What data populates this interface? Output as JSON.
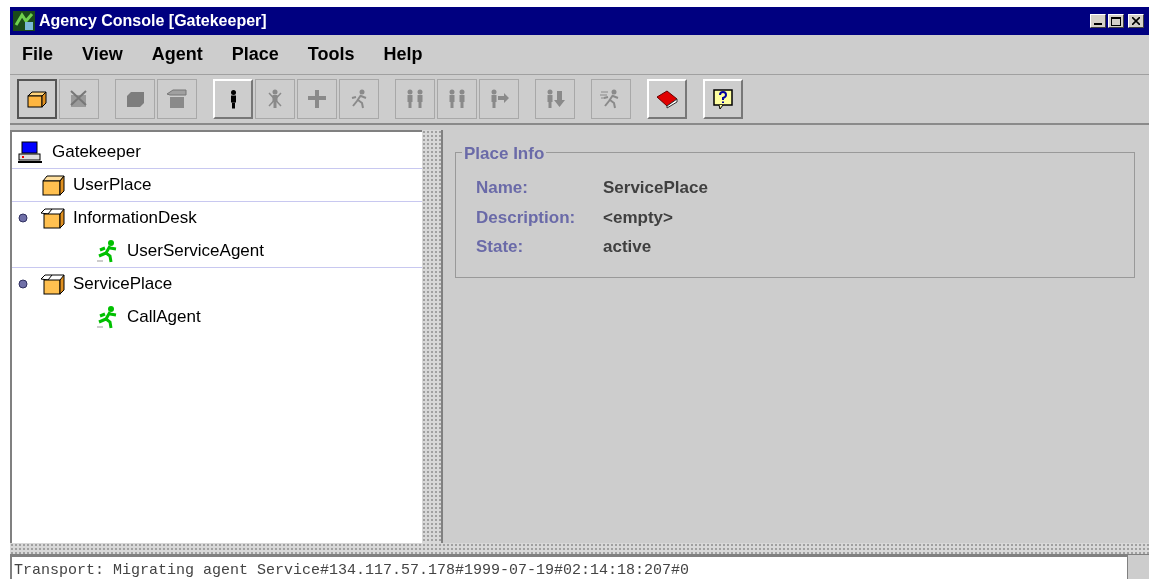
{
  "window": {
    "title": "Agency Console [Gatekeeper]"
  },
  "menu": [
    {
      "label": "File"
    },
    {
      "label": "View"
    },
    {
      "label": "Agent"
    },
    {
      "label": "Place"
    },
    {
      "label": "Tools"
    },
    {
      "label": "Help"
    }
  ],
  "toolbar": [
    [
      {
        "kind": "box",
        "disabled": false,
        "selected": true
      },
      {
        "kind": "box-x",
        "disabled": true,
        "selected": false
      }
    ],
    [
      {
        "kind": "cube",
        "disabled": true,
        "selected": false
      },
      {
        "kind": "box-open",
        "disabled": true,
        "selected": false
      }
    ],
    [
      {
        "kind": "person",
        "disabled": false,
        "selected": false
      },
      {
        "kind": "person-x",
        "disabled": true,
        "selected": false
      },
      {
        "kind": "person-plus",
        "disabled": true,
        "selected": false
      },
      {
        "kind": "runner",
        "disabled": true,
        "selected": false
      }
    ],
    [
      {
        "kind": "pair",
        "disabled": true,
        "selected": false
      },
      {
        "kind": "pair",
        "disabled": true,
        "selected": false
      },
      {
        "kind": "person-right",
        "disabled": true,
        "selected": false
      }
    ],
    [
      {
        "kind": "person-down",
        "disabled": true,
        "selected": false
      }
    ],
    [
      {
        "kind": "runner-fast",
        "disabled": true,
        "selected": false
      }
    ],
    [
      {
        "kind": "book",
        "disabled": false,
        "selected": false
      }
    ],
    [
      {
        "kind": "help",
        "disabled": false,
        "selected": false
      }
    ]
  ],
  "tree": {
    "label": "Gatekeeper",
    "kind": "host",
    "children": [
      {
        "label": "UserPlace",
        "kind": "place",
        "marked": false
      },
      {
        "label": "InformationDesk",
        "kind": "place-open",
        "marked": true,
        "children": [
          {
            "label": "UserServiceAgent",
            "kind": "agent"
          }
        ]
      },
      {
        "label": "ServicePlace",
        "kind": "place-open",
        "marked": true,
        "children": [
          {
            "label": "CallAgent",
            "kind": "agent"
          }
        ]
      }
    ]
  },
  "place_info": {
    "title": "Place Info",
    "fields": [
      {
        "label": "Name:",
        "value": "ServicePlace"
      },
      {
        "label": "Description:",
        "value": "<empty>"
      },
      {
        "label": "State:",
        "value": "active"
      }
    ]
  },
  "status_bar": {
    "text": "Transport: Migrating agent Service#134.117.57.178#1999-07-19#02:14:18:207#0"
  }
}
